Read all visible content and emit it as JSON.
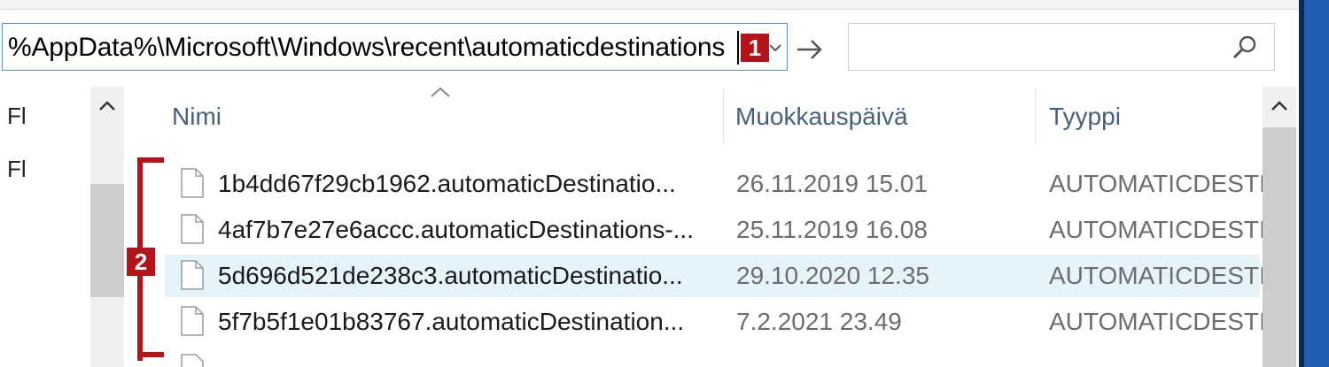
{
  "address_bar": {
    "path": "%AppData%\\Microsoft\\Windows\\recent\\automaticdestinations",
    "dropdown_icon": "chevron-down-icon"
  },
  "go_button": {
    "icon": "arrow-right-icon"
  },
  "search": {
    "placeholder": "",
    "icon": "search-icon"
  },
  "annotations": {
    "badge_1": "1",
    "badge_2": "2",
    "color": "#b4131a"
  },
  "navigation": {
    "items": [
      {
        "label": "Fl"
      },
      {
        "label": "Fl"
      }
    ]
  },
  "file_list": {
    "columns": [
      {
        "label": "Nimi"
      },
      {
        "label": "Muokkauspäivä"
      },
      {
        "label": "Tyyppi"
      }
    ],
    "rows": [
      {
        "name": "1b4dd67f29cb1962.automaticDestinatio...",
        "date": "26.11.2019 15.01",
        "type": "AUTOMATICDESTI..",
        "selected": false
      },
      {
        "name": "4af7b7e27e6accc.automaticDestinations-...",
        "date": "25.11.2019 16.08",
        "type": "AUTOMATICDESTI..",
        "selected": false
      },
      {
        "name": "5d696d521de238c3.automaticDestinatio...",
        "date": "29.10.2020 12.35",
        "type": "AUTOMATICDESTI..",
        "selected": true
      },
      {
        "name": "5f7b5f1e01b83767.automaticDestination...",
        "date": "7.2.2021 23.49",
        "type": "AUTOMATICDESTI..",
        "selected": false
      }
    ]
  },
  "colors": {
    "selection": "#e5f3fb",
    "header_text": "#46607f",
    "address_border": "#5b8fc7"
  }
}
